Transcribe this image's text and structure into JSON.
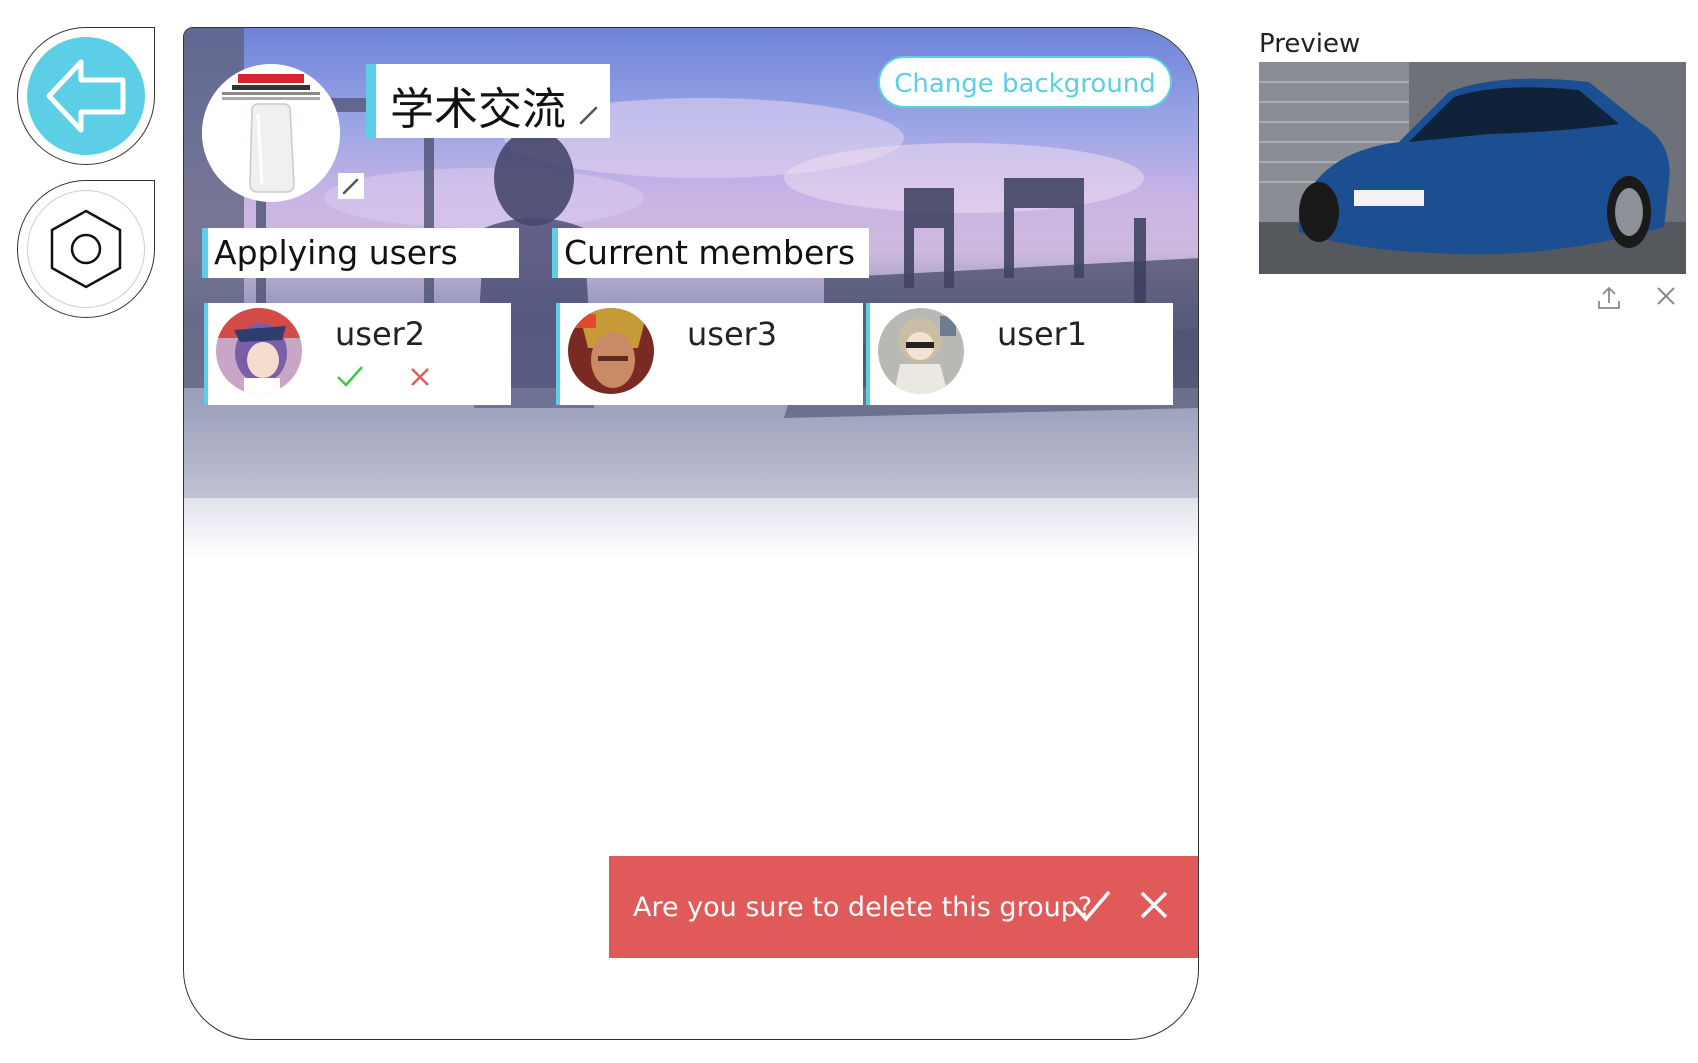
{
  "nav": {
    "back_icon": "back-arrow-icon",
    "settings_icon": "hexagon-settings-icon"
  },
  "group": {
    "name": "学术交流",
    "avatar_icon": "cola-glass-image",
    "change_background_label": "Change background"
  },
  "sections": {
    "applying_label": "Applying users",
    "members_label": "Current members"
  },
  "applying_users": [
    {
      "name": "user2",
      "accept_icon": "check-icon",
      "reject_icon": "close-icon"
    }
  ],
  "members": [
    {
      "name": "user3"
    },
    {
      "name": "user1"
    }
  ],
  "confirm_dialog": {
    "message": "Are you sure to delete this group?",
    "confirm_icon": "check-icon",
    "cancel_icon": "close-icon",
    "color": "#e05a5a"
  },
  "preview": {
    "label": "Preview",
    "share_icon": "upload-icon",
    "close_icon": "close-icon"
  },
  "colors": {
    "accent": "#5ccfe6",
    "danger": "#e05a5a",
    "accept": "#3cc94a",
    "reject": "#e25d5d"
  }
}
